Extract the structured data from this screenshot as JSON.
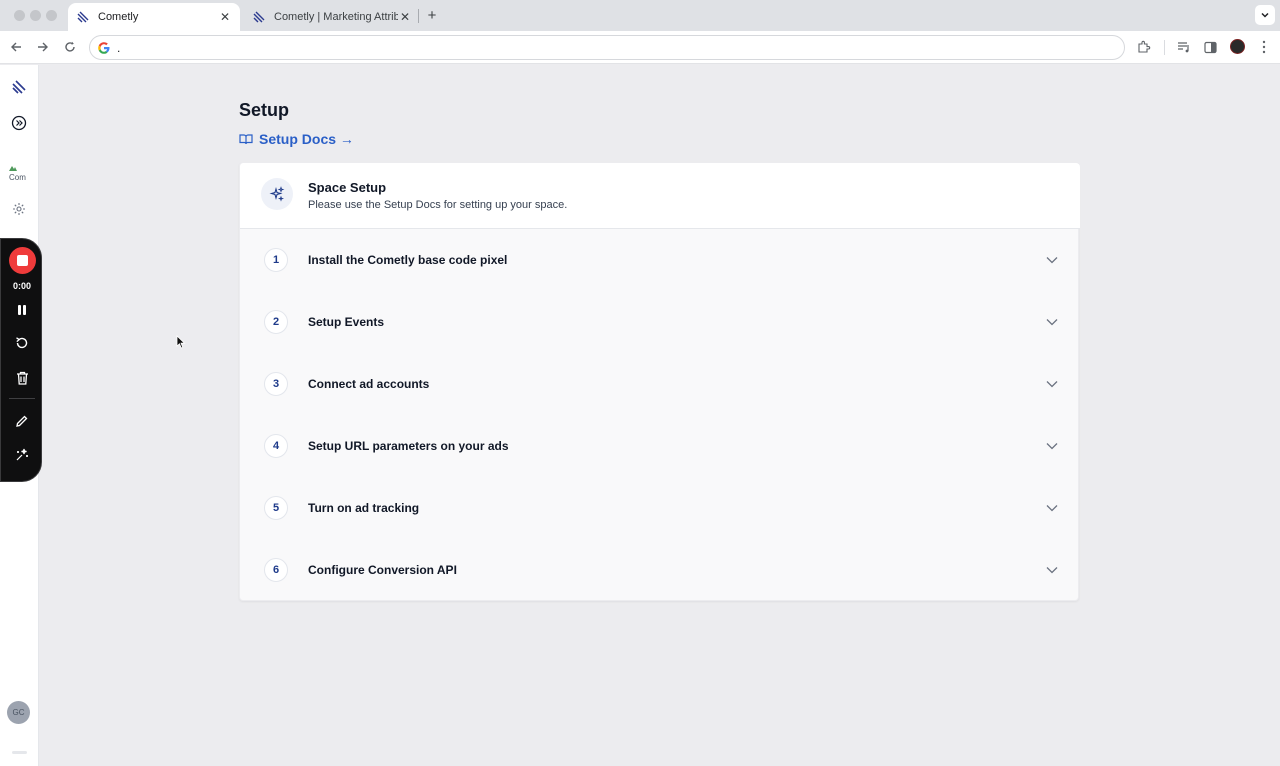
{
  "browser": {
    "tabs": [
      {
        "title": "Cometly",
        "active": true
      },
      {
        "title": "Cometly | Marketing Attributi",
        "active": false
      }
    ],
    "address_bar_text": "."
  },
  "recorder": {
    "elapsed": "0:00"
  },
  "sidebar": {
    "broken_image_alt": "Com",
    "user_initials": "GC"
  },
  "page": {
    "title": "Setup",
    "docs_link": "Setup Docs →"
  },
  "space_setup": {
    "title": "Space Setup",
    "subtitle": "Please use the Setup Docs for setting up your space."
  },
  "steps": [
    {
      "number": "1",
      "label": "Install the Cometly base code pixel"
    },
    {
      "number": "2",
      "label": "Setup Events"
    },
    {
      "number": "3",
      "label": "Connect ad accounts"
    },
    {
      "number": "4",
      "label": "Setup URL parameters on your ads"
    },
    {
      "number": "5",
      "label": "Turn on ad tracking"
    },
    {
      "number": "6",
      "label": "Configure Conversion API"
    }
  ],
  "colors": {
    "brand_blue": "#2a5fc7",
    "record_red": "#ef3b3b",
    "page_background": "#ececef"
  },
  "icons": {
    "docs": "book-open-icon",
    "space_setup": "sparkles-icon",
    "step_expand": "chevron-down-icon"
  }
}
